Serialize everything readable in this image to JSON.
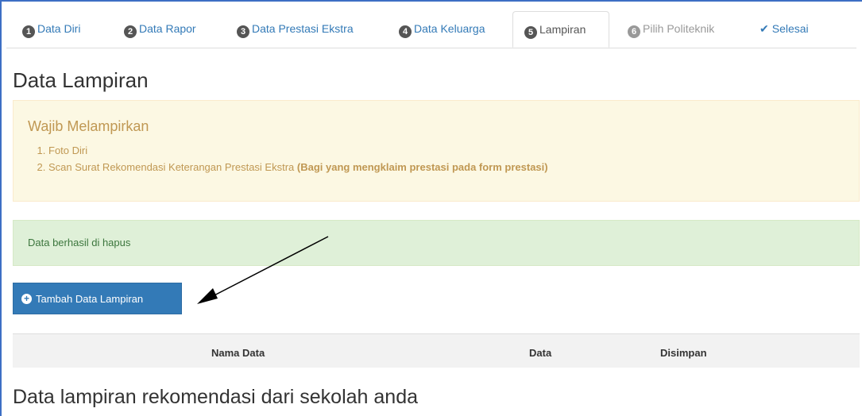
{
  "tabs": [
    {
      "num": "1",
      "label": "Data Diri"
    },
    {
      "num": "2",
      "label": "Data Rapor"
    },
    {
      "num": "3",
      "label": "Data Prestasi Ekstra"
    },
    {
      "num": "4",
      "label": "Data Keluarga"
    },
    {
      "num": "5",
      "label": "Lampiran"
    },
    {
      "num": "6",
      "label": "Pilih Politeknik"
    },
    {
      "num": "",
      "label": "Selesai"
    }
  ],
  "page_title": "Data Lampiran",
  "warning": {
    "title": "Wajib Melampirkan",
    "items": [
      {
        "text": "Foto Diri",
        "bold": ""
      },
      {
        "text": "Scan Surat Rekomendasi Keterangan Prestasi Ekstra ",
        "bold": "(Bagi yang mengklaim prestasi pada form prestasi)"
      }
    ]
  },
  "success_message": "Data berhasil di hapus",
  "add_button_label": "Tambah Data Lampiran",
  "table": {
    "columns": [
      "Nama Data",
      "Data",
      "Disimpan"
    ]
  },
  "section_title": "Data lampiran rekomendasi dari sekolah anda",
  "colors": {
    "primary": "#337ab7",
    "warning_bg": "#fcf8e3",
    "warning_text": "#c09853",
    "success_bg": "#dff0d8",
    "success_text": "#3c763d"
  }
}
